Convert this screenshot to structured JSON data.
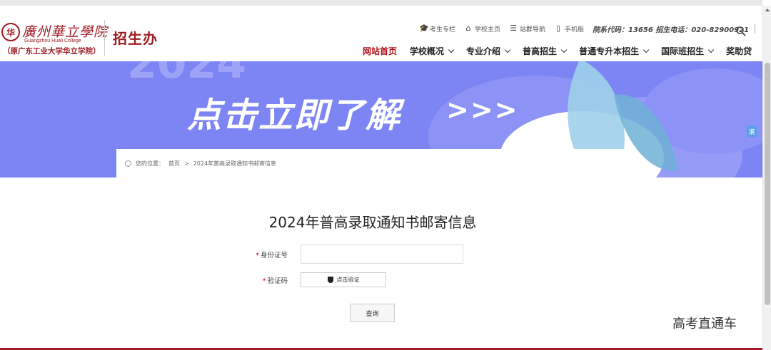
{
  "header": {
    "logo_seal": "华",
    "logo_cn": "廣州華立學院",
    "logo_en": "Guangzhou Huali College",
    "logo_sub": "（原广东工业大学华立学院）",
    "office": "招生办"
  },
  "toplinks": [
    {
      "icon": "graduation-cap-icon",
      "glyph": "🎓",
      "label": "考生专栏"
    },
    {
      "icon": "home-icon",
      "glyph": "⌂",
      "label": "学校主页"
    },
    {
      "icon": "list-icon",
      "glyph": "☰",
      "label": "站群导航"
    },
    {
      "icon": "phone-icon",
      "glyph": "▯",
      "label": "手机版"
    }
  ],
  "contact": "院系代码：13656 招生电话：020-82900921",
  "nav": [
    {
      "label": "网站首页",
      "active": true,
      "dropdown": false
    },
    {
      "label": "学校概况",
      "active": false,
      "dropdown": true
    },
    {
      "label": "专业介绍",
      "active": false,
      "dropdown": true
    },
    {
      "label": "普高招生",
      "active": false,
      "dropdown": true
    },
    {
      "label": "普通专升本招生",
      "active": false,
      "dropdown": true
    },
    {
      "label": "国际班招生",
      "active": false,
      "dropdown": true
    },
    {
      "label": "奖助贷",
      "active": false,
      "dropdown": false
    }
  ],
  "banner": {
    "cta": "点击立即了解",
    "arrows": ">>>",
    "side_tab": "滚"
  },
  "breadcrumb": {
    "prefix": "您的位置：",
    "home": "首页",
    "sep": ">",
    "current": "2024年普高录取通知书邮寄信息"
  },
  "form": {
    "title": "2024年普高录取通知书邮寄信息",
    "id_label": "身份证号",
    "id_value": "",
    "captcha_label": "验证码",
    "captcha_button": "点击验证",
    "required_mark": "*",
    "submit": "查询"
  },
  "watermark": "高考直通车",
  "colors": {
    "brand": "#9e1b22",
    "banner": "#7d84f4",
    "active_nav": "#b3121d"
  }
}
